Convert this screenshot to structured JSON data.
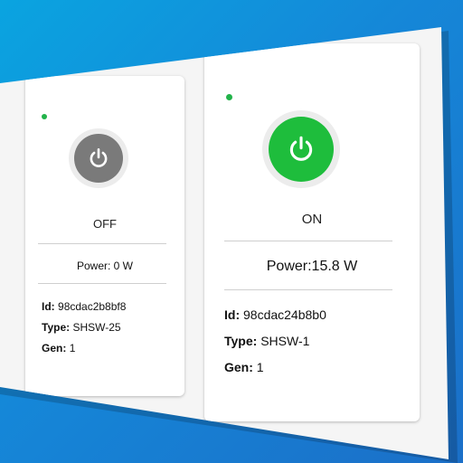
{
  "devices": [
    {
      "status_color": "#22b34a",
      "button_color": "#7a7a7a",
      "icon": "power-icon",
      "state": "OFF",
      "power_label": "Power:",
      "power_value": "0 W",
      "id_label": "Id:",
      "id_value": "98cdac2b8bf8",
      "type_label": "Type:",
      "type_value": "SHSW-25",
      "gen_label": "Gen:",
      "gen_value": "1"
    },
    {
      "status_color": "#22b34a",
      "button_color": "#1ebd3c",
      "icon": "power-icon",
      "state": "ON",
      "power_label": "Power:",
      "power_value": "15.8 W",
      "id_label": "Id:",
      "id_value": "98cdac24b8b0",
      "type_label": "Type:",
      "type_value": "SHSW-1",
      "gen_label": "Gen:",
      "gen_value": "1"
    }
  ]
}
